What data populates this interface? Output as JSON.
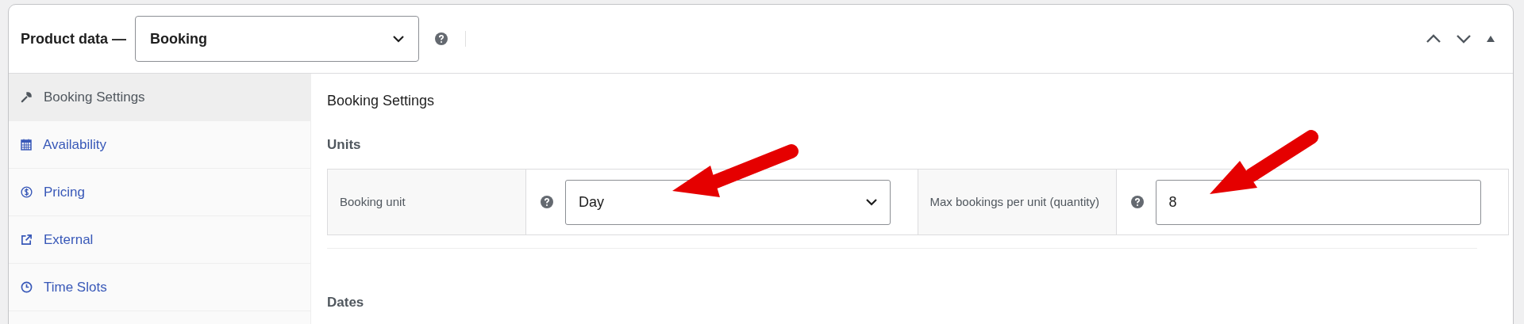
{
  "header": {
    "title": "Product data —",
    "product_type": {
      "value": "Booking"
    }
  },
  "tabs": [
    {
      "label": "Booking Settings",
      "selected": true,
      "kind": "wrench"
    },
    {
      "label": "Availability",
      "selected": false,
      "kind": "calendar"
    },
    {
      "label": "Pricing",
      "selected": false,
      "kind": "dollar"
    },
    {
      "label": "External",
      "selected": false,
      "kind": "external"
    },
    {
      "label": "Time Slots",
      "selected": false,
      "kind": "clock"
    }
  ],
  "panel": {
    "title": "Booking Settings",
    "sections": [
      {
        "heading": "Units"
      },
      {
        "heading": "Dates"
      }
    ],
    "fields": [
      {
        "label": "Booking unit",
        "kind": "select",
        "value": "Day"
      },
      {
        "label": "Max bookings per unit (quantity)",
        "kind": "text",
        "value": "8"
      }
    ]
  }
}
